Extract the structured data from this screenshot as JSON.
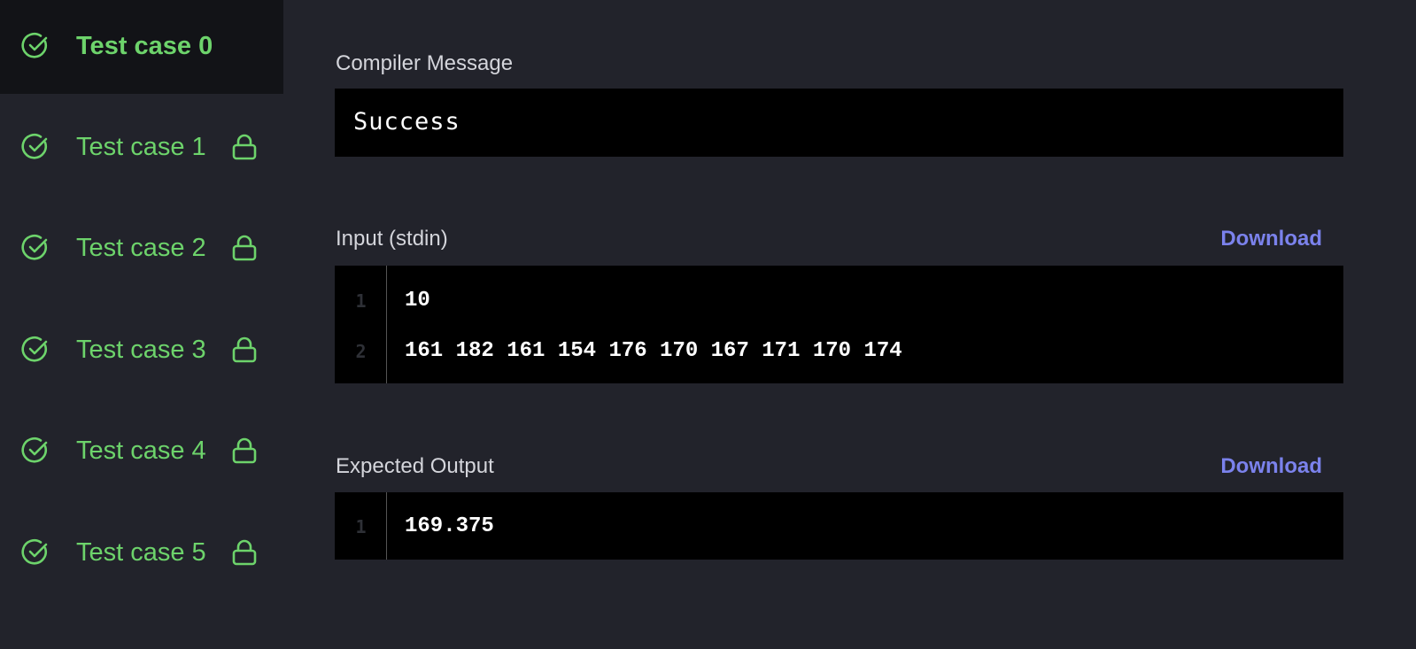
{
  "sidebar": {
    "items": [
      {
        "label": "Test case 0",
        "status": "passed",
        "locked": false,
        "active": true
      },
      {
        "label": "Test case 1",
        "status": "passed",
        "locked": true
      },
      {
        "label": "Test case 2",
        "status": "passed",
        "locked": true
      },
      {
        "label": "Test case 3",
        "status": "passed",
        "locked": true
      },
      {
        "label": "Test case 4",
        "status": "passed",
        "locked": true
      },
      {
        "label": "Test case 5",
        "status": "passed",
        "locked": true
      }
    ]
  },
  "compiler": {
    "label": "Compiler Message",
    "message": "Success"
  },
  "input": {
    "label": "Input (stdin)",
    "download": "Download",
    "lines": [
      {
        "n": "1",
        "text": "10"
      },
      {
        "n": "2",
        "text": "161 182 161 154 176 170 167 171 170 174"
      }
    ]
  },
  "expected": {
    "label": "Expected Output",
    "download": "Download",
    "lines": [
      {
        "n": "1",
        "text": "169.375"
      }
    ]
  },
  "colors": {
    "success": "#6dd36b",
    "link": "#7b82ec"
  }
}
